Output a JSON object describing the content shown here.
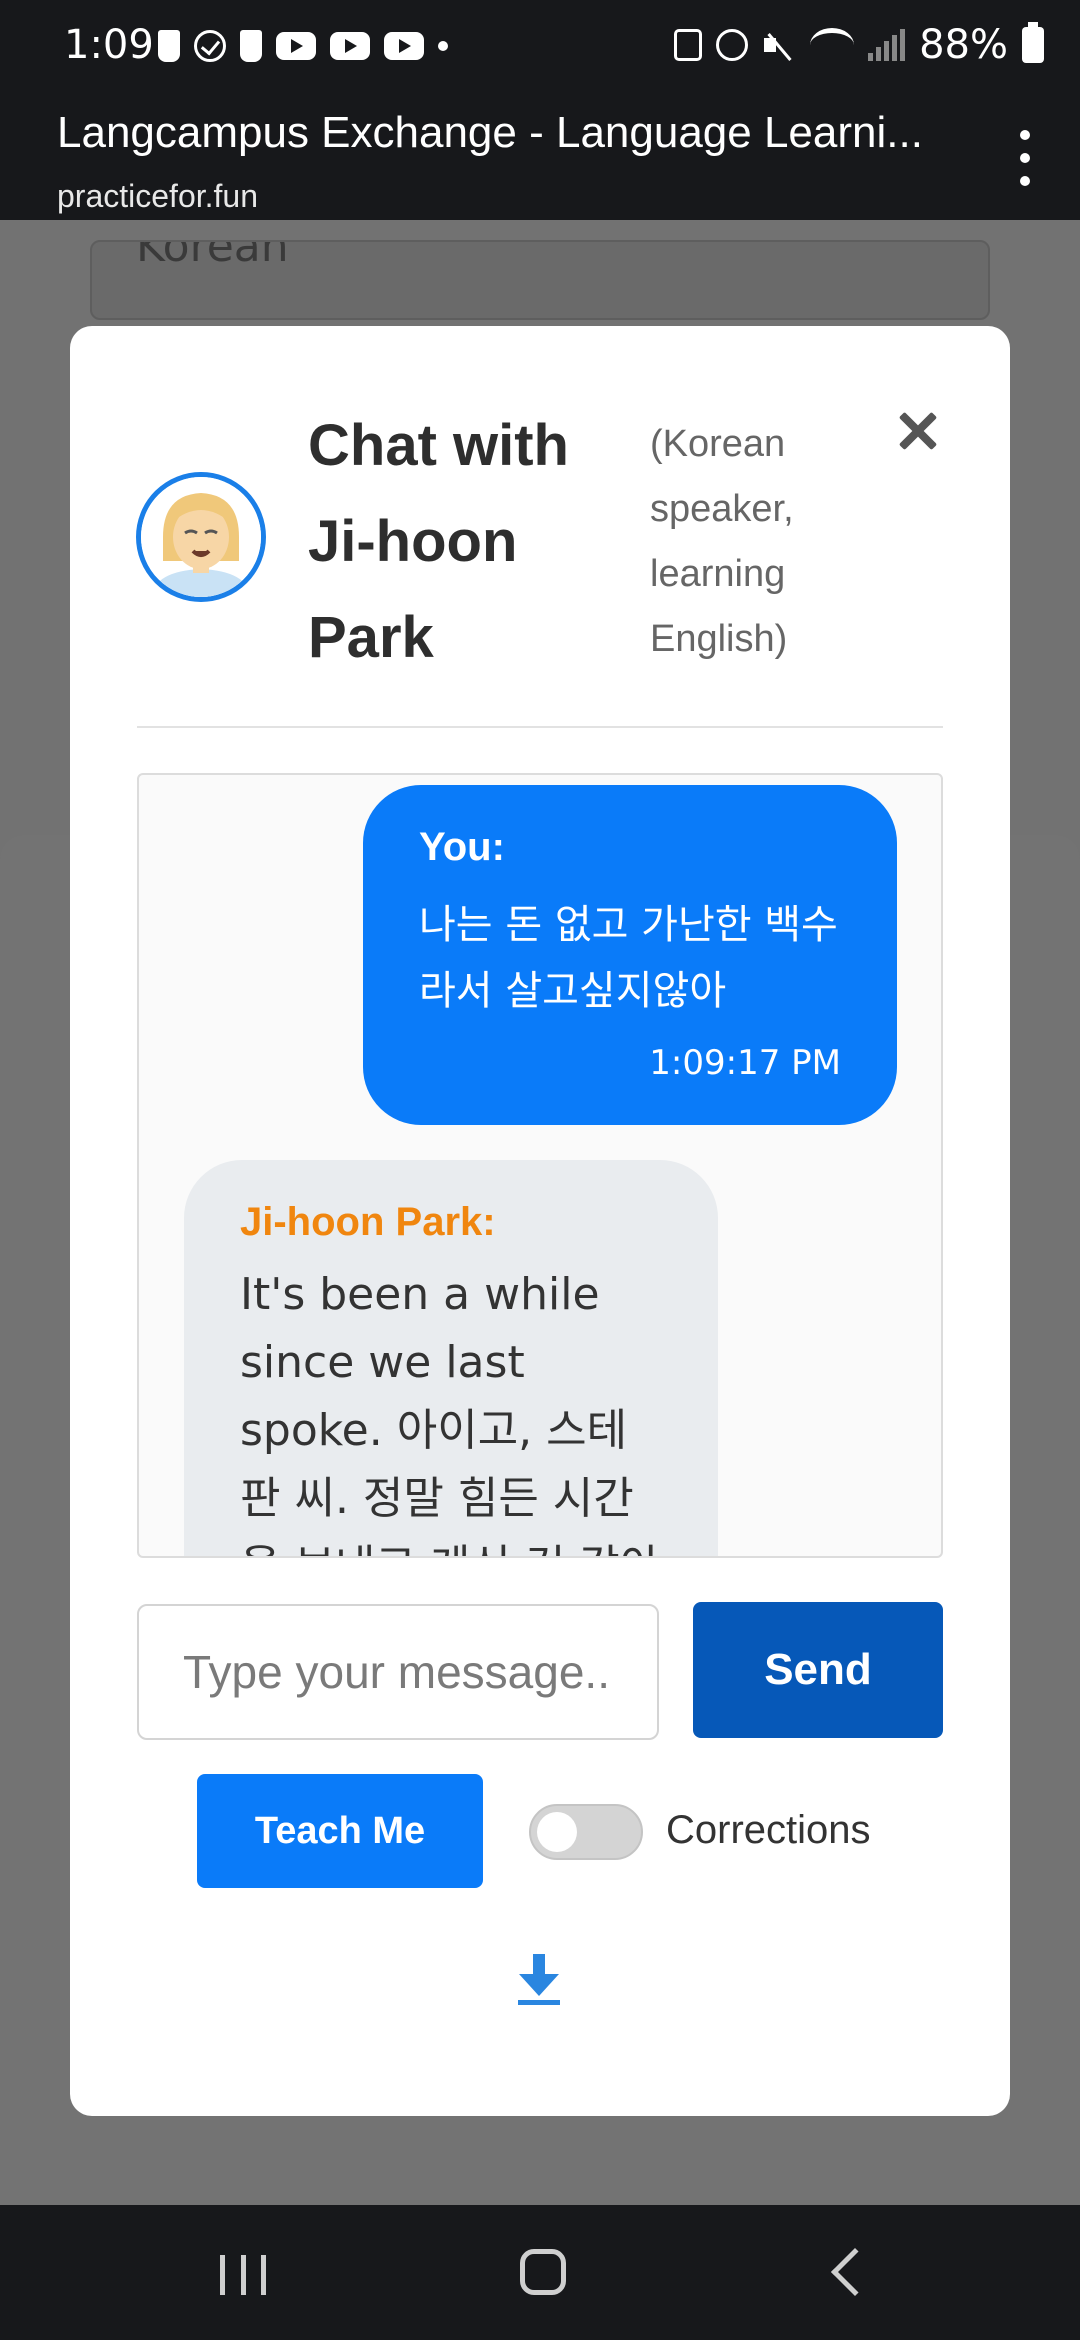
{
  "status_bar": {
    "time": "1:09",
    "battery_percent": "88%",
    "left_icons": [
      "cup-icon",
      "check-circle-icon",
      "cup-icon",
      "youtube-icon",
      "youtube-icon",
      "youtube-icon",
      "dot-icon"
    ],
    "right_icons": [
      "battery-saver-icon",
      "alarm-icon",
      "mute-icon",
      "wifi-icon",
      "signal-icon",
      "battery-icon"
    ]
  },
  "browser": {
    "page_title": "Langcampus Exchange - Language Learni...",
    "url": "practicefor.fun"
  },
  "background": {
    "select_value": "Korean"
  },
  "modal": {
    "title": "Chat with Ji-hoon Park",
    "subtitle": "(Korean speaker, learning English)",
    "messages": [
      {
        "sender": "You:",
        "text": "나는 돈 없고 가난한 백수라서 살고싶지않아",
        "time": "1:09:17 PM"
      },
      {
        "sender": "Ji-hoon Park:",
        "text": "It's been a while since we last spoke. 아이고, 스테판 씨. 정말 힘든 시간을 보내고 계신 것 같아요."
      }
    ],
    "input_placeholder": "Type your message...",
    "send_label": "Send",
    "teach_label": "Teach Me",
    "corrections_label": "Corrections",
    "corrections_enabled": false
  },
  "colors": {
    "accent_blue": "#0a7bf9",
    "send_blue": "#0658b8",
    "partner_name_orange": "#f0860f",
    "partner_bubble": "#e9ecef"
  }
}
